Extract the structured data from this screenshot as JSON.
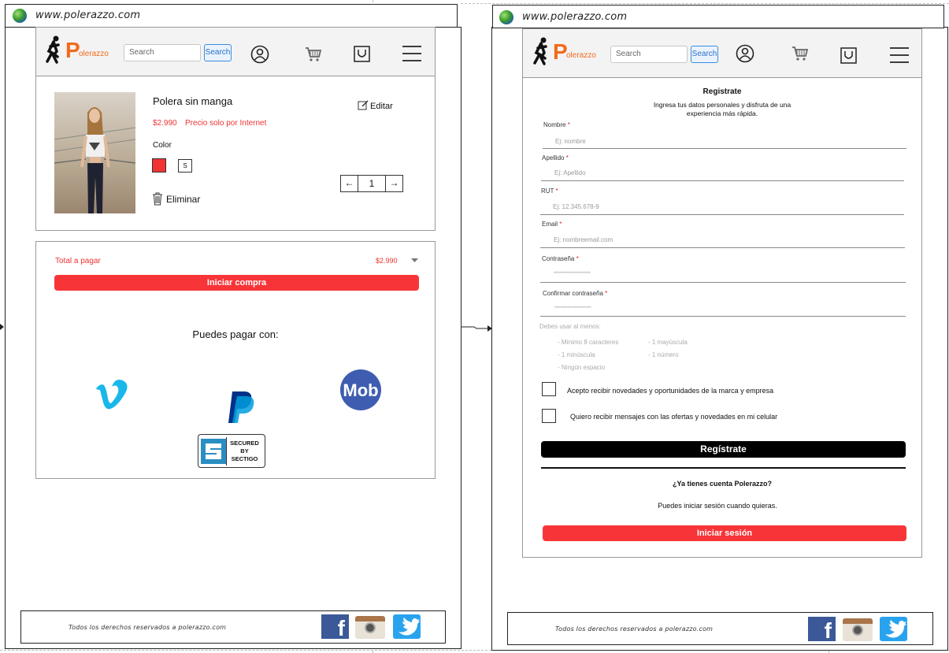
{
  "url": "www.polerazzo.com",
  "brand": {
    "letter": "P",
    "rest": "olerazzo"
  },
  "search": {
    "placeholder": "Search",
    "button": "Search"
  },
  "cart": {
    "product_name": "Polera sin manga",
    "price": "$2.990",
    "price_note": "Precio solo por Internet",
    "color_label": "Color",
    "selected_color": "#f03434",
    "size": "S",
    "edit_label": "Editar",
    "delete_label": "Eliminar",
    "quantity": "1",
    "total_label": "Total a pagar",
    "total_value": "$2.990",
    "checkout_button": "Iniciar compra",
    "pay_with": "Puedes pagar con:",
    "payment_icons": [
      "vimeo-icon",
      "paypal-icon",
      "mob-icon"
    ],
    "mob_text": "Mob",
    "sectigo": [
      "SECURED",
      "BY",
      "SECTIGO"
    ]
  },
  "register": {
    "title": "Registrate",
    "subtitle_line1": "Ingresa tus datos personales y disfruta de una",
    "subtitle_line2": "experiencia más rápida.",
    "fields": [
      {
        "label": "Nombre",
        "placeholder": "Ej: nombre"
      },
      {
        "label": "Apellido",
        "placeholder": "Ej: Apellido"
      },
      {
        "label": "RUT",
        "placeholder": "Ej: 12.345.678-9"
      },
      {
        "label": "Email",
        "placeholder": "Ej: nombreemail.com"
      },
      {
        "label": "Contraseña",
        "placeholder": "********************"
      },
      {
        "label": "Confirmar contraseña",
        "placeholder": "********************"
      }
    ],
    "rules_title": "Debes usar al menos:",
    "rules": [
      "- Mínimo 8 caracteres",
      "- 1 mayúscula",
      "- 1 minúscula",
      "- 1 número",
      "- Ningún espacio"
    ],
    "checkbox1": "Acepto recibir novedades y oportunidades de la marca y empresa",
    "checkbox2": "Quiero recibir mensajes con las ofertas y novedades en mi celular",
    "register_button": "Regístrate",
    "have_account": "¿Ya tienes cuenta Polerazzo?",
    "login_hint": "Puedes iniciar sesión cuando quieras.",
    "login_button": "Iniciar sesión"
  },
  "footer": {
    "text": "Todos los derechos reservados a polerazzo.com",
    "social": [
      "facebook-icon",
      "instagram-icon",
      "twitter-icon"
    ]
  },
  "colors": {
    "accent": "#f73539",
    "brand": "#f26a1b",
    "link_blue": "#2a6fc9"
  }
}
